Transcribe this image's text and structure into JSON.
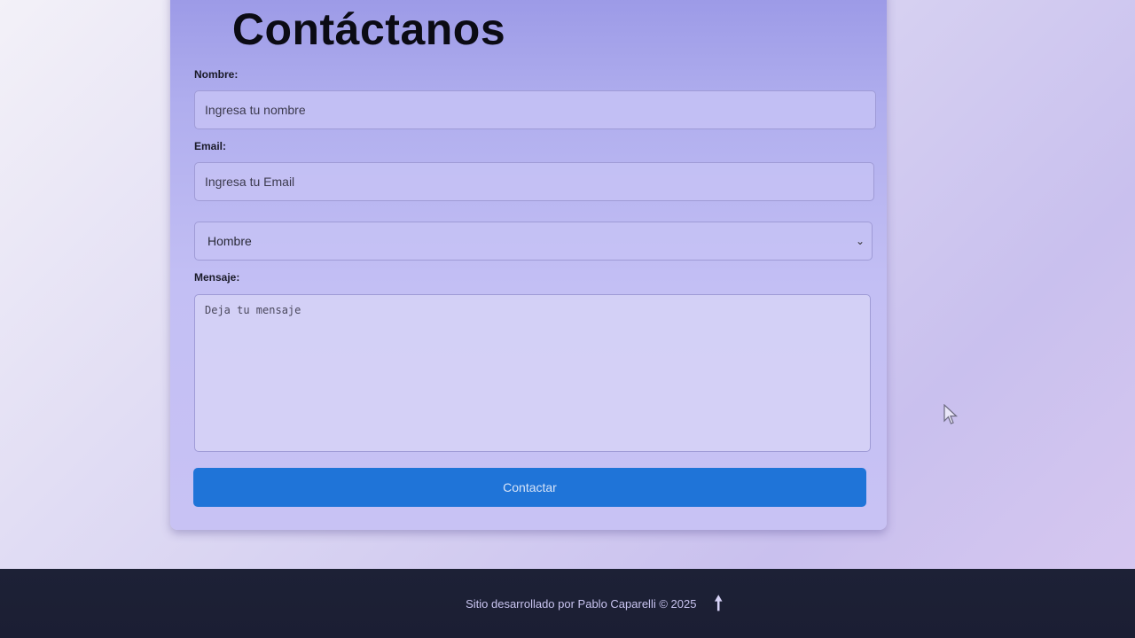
{
  "form": {
    "title": "Contáctanos",
    "name_label": "Nombre:",
    "name_placeholder": "Ingresa tu nombre",
    "email_label": "Email:",
    "email_placeholder": "Ingresa tu Email",
    "gender_selected": "Hombre",
    "message_label": "Mensaje:",
    "message_placeholder": "Deja tu mensaje",
    "submit_label": "Contactar"
  },
  "footer": {
    "text": "Sitio desarrollado por Pablo Caparelli © 2025",
    "back_to_top_icon": "up-arrow-icon"
  },
  "colors": {
    "button_bg": "#1f74d8",
    "footer_bg": "#1d2136",
    "card_bg": "#b0aeee"
  }
}
